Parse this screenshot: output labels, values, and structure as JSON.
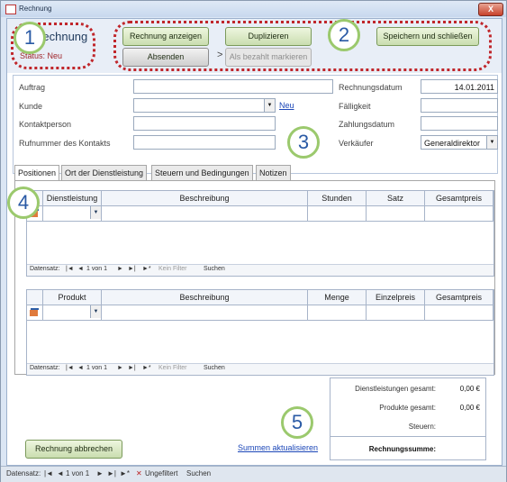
{
  "window": {
    "title": "Rechnung",
    "close_label": "X"
  },
  "header": {
    "form_title": "Rechnung",
    "status": "Status: Neu",
    "buttons": {
      "show_invoice": "Rechnung anzeigen",
      "duplicate": "Duplizieren",
      "save_close": "Speichern und schließen",
      "send": "Absenden",
      "arrow": ">",
      "mark_paid": "Als bezahlt markieren"
    }
  },
  "fields": {
    "left": [
      {
        "label": "Auftrag",
        "value": ""
      },
      {
        "label": "Kunde",
        "value": ""
      },
      {
        "label": "Kontaktperson",
        "value": ""
      },
      {
        "label": "Rufnummer des Kontakts",
        "value": ""
      }
    ],
    "new_link": "Neu",
    "right": [
      {
        "label": "Rechnungsdatum",
        "value": "14.01.2011"
      },
      {
        "label": "Fälligkeit",
        "value": ""
      },
      {
        "label": "Zahlungsdatum",
        "value": ""
      },
      {
        "label": "Verkäufer",
        "value": "Generaldirektor"
      }
    ]
  },
  "tabs": [
    "Positionen",
    "Ort der Dienstleistung",
    "Steuern und Bedingungen",
    "Notizen"
  ],
  "services_grid": {
    "columns": [
      "Dienstleistung",
      "Beschreibung",
      "Stunden",
      "Satz",
      "Gesamtpreis"
    ],
    "nav": {
      "label": "Datensatz:",
      "position": "1 von 1",
      "filter": "Kein Filter",
      "search": "Suchen"
    }
  },
  "products_grid": {
    "columns": [
      "Produkt",
      "Beschreibung",
      "Menge",
      "Einzelpreis",
      "Gesamtpreis"
    ],
    "nav": {
      "label": "Datensatz:",
      "position": "1 von 1",
      "filter": "Kein Filter",
      "search": "Suchen"
    }
  },
  "footer": {
    "cancel_button": "Rechnung abbrechen",
    "update_link": "Summen aktualisieren"
  },
  "totals": {
    "services_label": "Dienstleistungen gesamt:",
    "services_value": "0,00 €",
    "products_label": "Produkte gesamt:",
    "products_value": "0,00 €",
    "tax_label": "Steuern:",
    "sum_label": "Rechnungssumme:"
  },
  "callouts": [
    "1",
    "2",
    "3",
    "4",
    "5"
  ],
  "statusbar": {
    "label": "Datensatz:",
    "position": "1 von 1",
    "filter": "Ungefiltert",
    "search": "Suchen"
  }
}
